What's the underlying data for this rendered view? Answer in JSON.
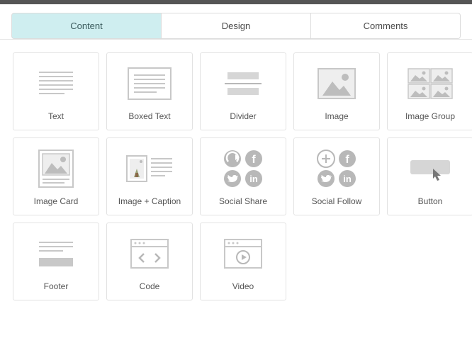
{
  "tabs": [
    {
      "label": "Content",
      "active": true
    },
    {
      "label": "Design",
      "active": false
    },
    {
      "label": "Comments",
      "active": false
    }
  ],
  "blocks": [
    {
      "id": "text",
      "label": "Text"
    },
    {
      "id": "boxed-text",
      "label": "Boxed Text"
    },
    {
      "id": "divider",
      "label": "Divider"
    },
    {
      "id": "image",
      "label": "Image"
    },
    {
      "id": "image-group",
      "label": "Image Group"
    },
    {
      "id": "image-card",
      "label": "Image Card"
    },
    {
      "id": "image-caption",
      "label": "Image + Caption"
    },
    {
      "id": "social-share",
      "label": "Social Share"
    },
    {
      "id": "social-follow",
      "label": "Social Follow"
    },
    {
      "id": "button",
      "label": "Button"
    },
    {
      "id": "footer",
      "label": "Footer"
    },
    {
      "id": "code",
      "label": "Code"
    },
    {
      "id": "video",
      "label": "Video"
    }
  ],
  "colors": {
    "accent": "#cfeef0",
    "icon": "#b8b8b8",
    "iconLight": "#d6d6d6",
    "border": "#e2e2e2"
  }
}
